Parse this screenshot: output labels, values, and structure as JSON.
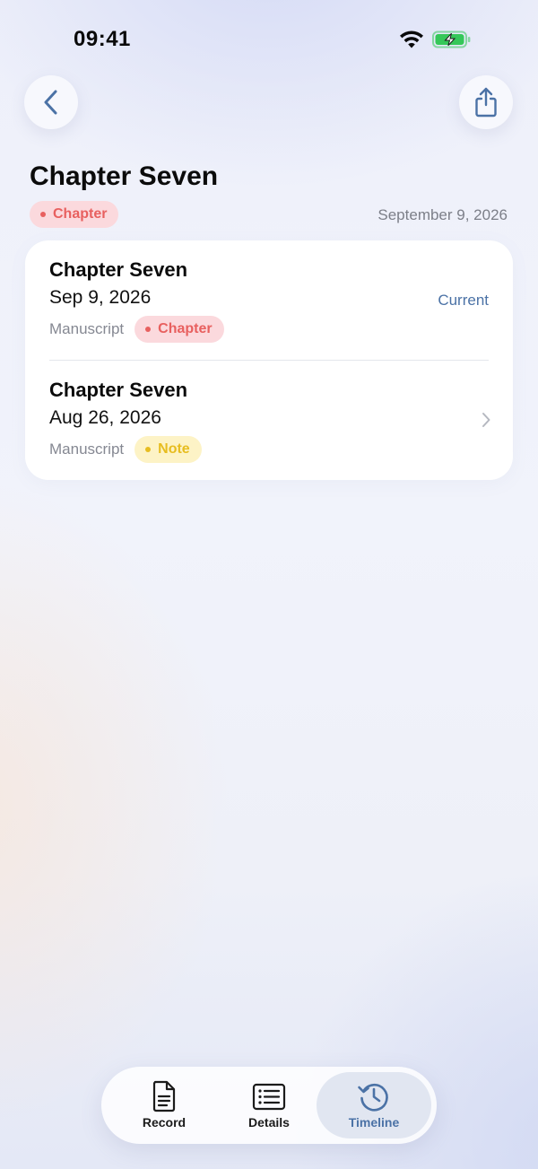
{
  "status_bar": {
    "time": "09:41"
  },
  "header": {
    "title": "Chapter Seven",
    "badge": "Chapter",
    "date": "September 9, 2026"
  },
  "timeline": [
    {
      "title": "Chapter Seven",
      "date": "Sep 9, 2026",
      "source": "Manuscript",
      "badge": "Chapter",
      "status": "Current"
    },
    {
      "title": "Chapter Seven",
      "date": "Aug 26, 2026",
      "source": "Manuscript",
      "badge": "Note"
    }
  ],
  "tabbar": {
    "tabs": [
      {
        "label": "Record",
        "icon": "document-icon"
      },
      {
        "label": "Details",
        "icon": "list-icon"
      },
      {
        "label": "Timeline",
        "icon": "history-icon",
        "selected": true
      }
    ]
  },
  "colors": {
    "accent": "#4b72a6",
    "chapter_badge_bg": "#fbd9dd",
    "chapter_badge_fg": "#e8605f",
    "note_badge_bg": "#fdf3c6",
    "note_badge_fg": "#e7bd20",
    "battery_green": "#35c759"
  }
}
